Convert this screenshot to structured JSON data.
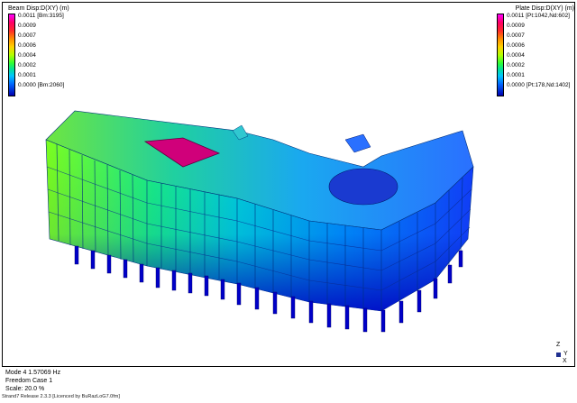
{
  "legend_left": {
    "title": "Beam Disp:D(XY)  (m)",
    "labels": [
      "0.0011 [Bm:3195]",
      "0.0009",
      "0.0007",
      "0.0006",
      "0.0004",
      "0.0002",
      "0.0001",
      "0.0000 [Bm:2060]"
    ]
  },
  "legend_right": {
    "title": "Plate Disp:D(XY)  (m)",
    "labels": [
      "0.0011 [Pt:1042,Nd:602]",
      "0.0009",
      "0.0007",
      "0.0006",
      "0.0004",
      "0.0002",
      "0.0001",
      "0.0000 [Pt:178,Nd:1402]"
    ]
  },
  "info": {
    "mode": "Mode 4   1.57069 Hz",
    "freedom": "Freedom Case 1",
    "scale": "Scale: 20.0 %"
  },
  "footer": "Strand7 Release 2.3.3 [Licenced by BuRazLoG7.0fm]",
  "axes": {
    "z": "Z",
    "y": "Y",
    "x": "X"
  },
  "colors": {
    "max": "#ff00ff",
    "high": "#b4ff00",
    "mid": "#00c4ff",
    "low": "#0000b0"
  }
}
